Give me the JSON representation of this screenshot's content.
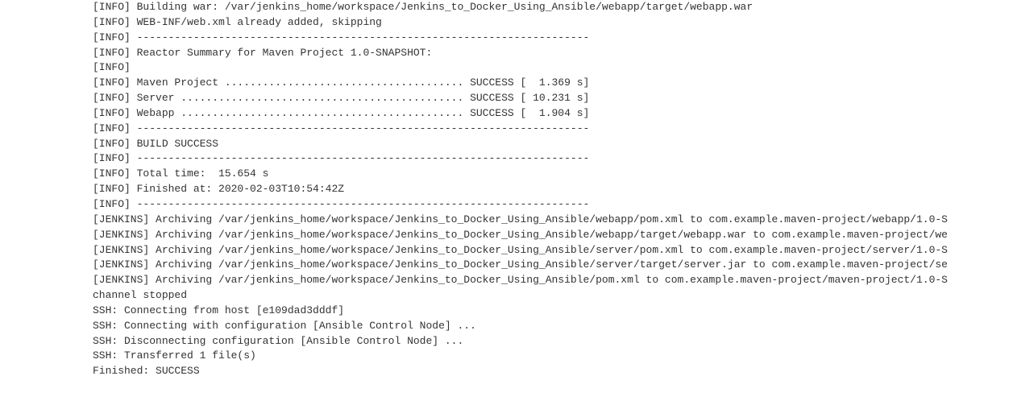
{
  "console": {
    "lines": [
      "[INFO] Building war: /var/jenkins_home/workspace/Jenkins_to_Docker_Using_Ansible/webapp/target/webapp.war",
      "[INFO] WEB-INF/web.xml already added, skipping",
      "[INFO] ------------------------------------------------------------------------",
      "[INFO] Reactor Summary for Maven Project 1.0-SNAPSHOT:",
      "[INFO] ",
      "[INFO] Maven Project ...................................... SUCCESS [  1.369 s]",
      "[INFO] Server ............................................. SUCCESS [ 10.231 s]",
      "[INFO] Webapp ............................................. SUCCESS [  1.904 s]",
      "[INFO] ------------------------------------------------------------------------",
      "[INFO] BUILD SUCCESS",
      "[INFO] ------------------------------------------------------------------------",
      "[INFO] Total time:  15.654 s",
      "[INFO] Finished at: 2020-02-03T10:54:42Z",
      "[INFO] ------------------------------------------------------------------------",
      "[JENKINS] Archiving /var/jenkins_home/workspace/Jenkins_to_Docker_Using_Ansible/webapp/pom.xml to com.example.maven-project/webapp/1.0-S",
      "[JENKINS] Archiving /var/jenkins_home/workspace/Jenkins_to_Docker_Using_Ansible/webapp/target/webapp.war to com.example.maven-project/we",
      "[JENKINS] Archiving /var/jenkins_home/workspace/Jenkins_to_Docker_Using_Ansible/server/pom.xml to com.example.maven-project/server/1.0-S",
      "[JENKINS] Archiving /var/jenkins_home/workspace/Jenkins_to_Docker_Using_Ansible/server/target/server.jar to com.example.maven-project/se",
      "[JENKINS] Archiving /var/jenkins_home/workspace/Jenkins_to_Docker_Using_Ansible/pom.xml to com.example.maven-project/maven-project/1.0-S",
      "channel stopped",
      "SSH: Connecting from host [e109dad3dddf]",
      "SSH: Connecting with configuration [Ansible Control Node] ...",
      "SSH: Disconnecting configuration [Ansible Control Node] ...",
      "SSH: Transferred 1 file(s)",
      "Finished: SUCCESS"
    ]
  }
}
